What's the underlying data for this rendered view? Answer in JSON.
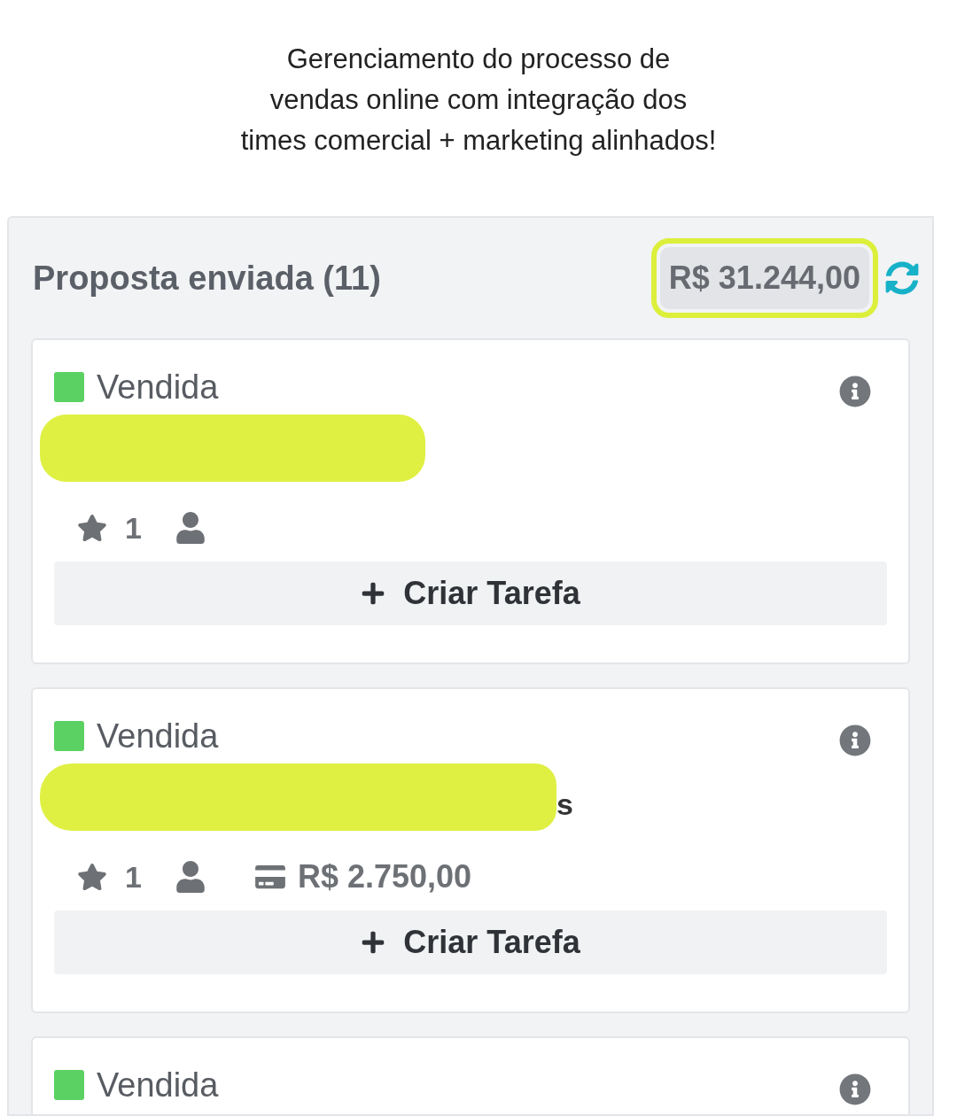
{
  "caption": "Gerenciamento do processo de\nvendas online com integração dos\ntimes comercial + marketing alinhados!",
  "column": {
    "title": "Proposta enviada (11)",
    "total": "R$ 31.244,00",
    "total_highlighted": true,
    "cards": [
      {
        "status": "Vendida",
        "color": "#5cd163",
        "redacted": true,
        "rating": "1",
        "button": "Criar Tarefa"
      },
      {
        "status": "Vendida",
        "color": "#5cd163",
        "redacted": true,
        "name": "s",
        "rating": "1",
        "amount": "R$ 2.750,00",
        "button": "Criar Tarefa"
      },
      {
        "status": "Vendida",
        "color": "#5cd163",
        "redacted": false
      }
    ]
  }
}
